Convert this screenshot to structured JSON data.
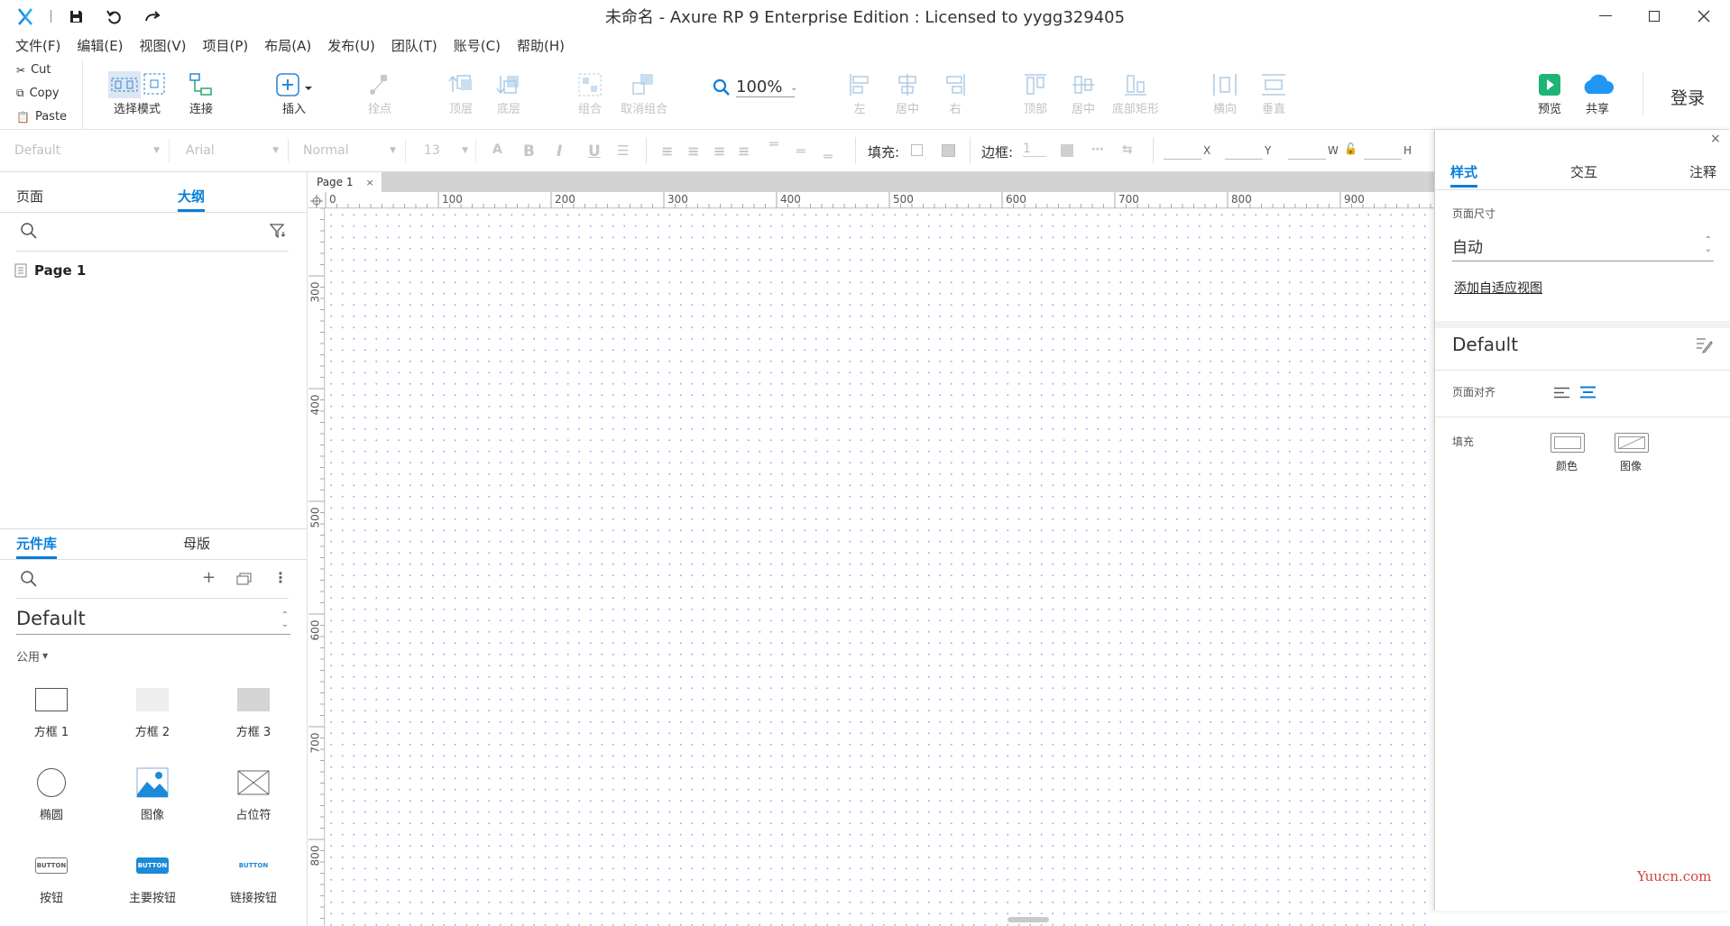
{
  "titlebar": {
    "title": "未命名 - Axure RP 9 Enterprise Edition : Licensed to yygg329405"
  },
  "menu": [
    "文件(F)",
    "编辑(E)",
    "视图(V)",
    "项目(P)",
    "布局(A)",
    "发布(U)",
    "团队(T)",
    "账号(C)",
    "帮助(H)"
  ],
  "clipboard": {
    "cut": "Cut",
    "copy": "Copy",
    "paste": "Paste"
  },
  "toolbar": {
    "select_mode": "选择模式",
    "connect": "连接",
    "insert": "插入",
    "point": "拴点",
    "top": "顶层",
    "bottom": "底层",
    "group": "组合",
    "ungroup": "取消组合",
    "zoom": "100%",
    "left": "左",
    "center": "居中",
    "right": "右",
    "top_align": "顶部",
    "middle": "居中",
    "bottom_align": "底部矩形",
    "horizontal": "横向",
    "vertical": "垂直",
    "preview": "预览",
    "share": "共享",
    "login": "登录"
  },
  "format": {
    "style": "Default",
    "font": "Arial",
    "weight": "Normal",
    "size": "13",
    "fill_label": "填充:",
    "border_label": "边框:",
    "border_value": "1",
    "x": "X",
    "y": "Y",
    "w": "W",
    "h": "H"
  },
  "left_top": {
    "tab_pages": "页面",
    "tab_outline": "大纲",
    "page_item": "Page 1"
  },
  "left_bottom": {
    "tab_library": "元件库",
    "tab_masters": "母版",
    "library_name": "Default",
    "category": "公用",
    "widgets": [
      "方框 1",
      "方框 2",
      "方框 3",
      "椭圆",
      "图像",
      "占位符",
      "按钮",
      "主要按钮",
      "链接按钮"
    ],
    "button_text": "BUTTON"
  },
  "canvas": {
    "tab": "Page 1",
    "ruler_h": [
      "0",
      "100",
      "200",
      "300",
      "400",
      "500",
      "600",
      "700",
      "800",
      "900"
    ],
    "ruler_v": [
      "300",
      "400",
      "500",
      "600",
      "700",
      "800"
    ]
  },
  "right": {
    "tab_style": "样式",
    "tab_interact": "交互",
    "tab_notes": "注释",
    "page_size_label": "页面尺寸",
    "page_size_value": "自动",
    "add_adaptive": "添加自适应视图",
    "style_name": "Default",
    "page_align": "页面对齐",
    "fill": "填充",
    "fill_color": "颜色",
    "fill_image": "图像"
  },
  "watermark": "Yuucn.com",
  "colors": {
    "accent": "#0a7ed8",
    "preview_green": "#1db476",
    "share_blue": "#2196f3",
    "grid_dot": "#9aa8f5"
  }
}
